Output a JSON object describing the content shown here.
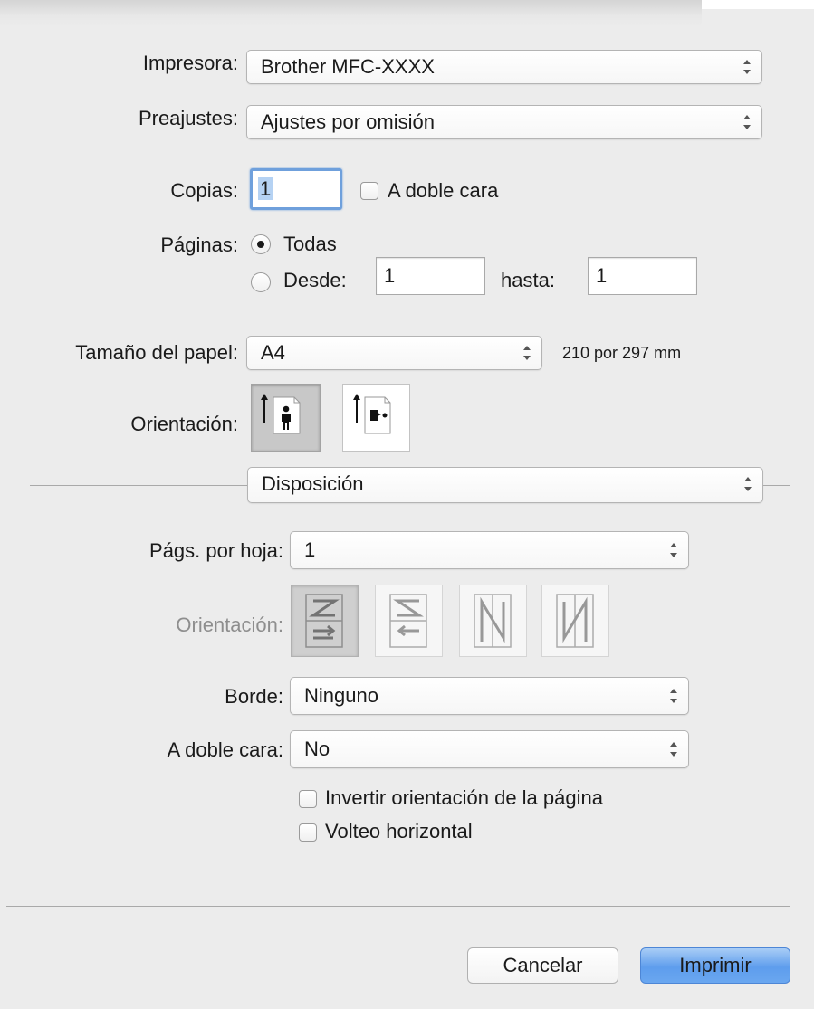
{
  "labels": {
    "printer": "Impresora:",
    "presets": "Preajustes:",
    "copies": "Copias:",
    "pages": "Páginas:",
    "paper_size": "Tamaño del papel:",
    "orientation": "Orientación:",
    "pages_per_sheet": "Págs. por hoja:",
    "layout_direction": "Orientación:",
    "border": "Borde:",
    "two_sided": "A doble cara:"
  },
  "printer": {
    "value": "Brother MFC-XXXX"
  },
  "presets": {
    "value": "Ajustes por omisión"
  },
  "copies": {
    "value": "1",
    "two_sided_label": "A doble cara",
    "two_sided_checked": false
  },
  "pages": {
    "all_label": "Todas",
    "all_selected": true,
    "from_label": "Desde:",
    "from_value": "1",
    "to_label": "hasta:",
    "to_value": "1"
  },
  "paper": {
    "value": "A4",
    "dimensions": "210 por 297 mm"
  },
  "orientation": {
    "selected": "portrait",
    "options": [
      "portrait-icon",
      "landscape-icon"
    ]
  },
  "section": {
    "value": "Disposición"
  },
  "layout": {
    "pages_per_sheet": "1",
    "directions": [
      "z-order-icon",
      "s-order-icon",
      "n-reverse-order-icon",
      "n-order-icon"
    ],
    "border": "Ninguno",
    "two_sided": "No",
    "reverse_label": "Invertir orientación de la página",
    "reverse_checked": false,
    "flip_label": "Volteo horizontal",
    "flip_checked": false
  },
  "buttons": {
    "cancel": "Cancelar",
    "print": "Imprimir"
  },
  "colors": {
    "accent": "#5e9ded",
    "focus": "#6fa0dc",
    "background": "#ececec"
  }
}
